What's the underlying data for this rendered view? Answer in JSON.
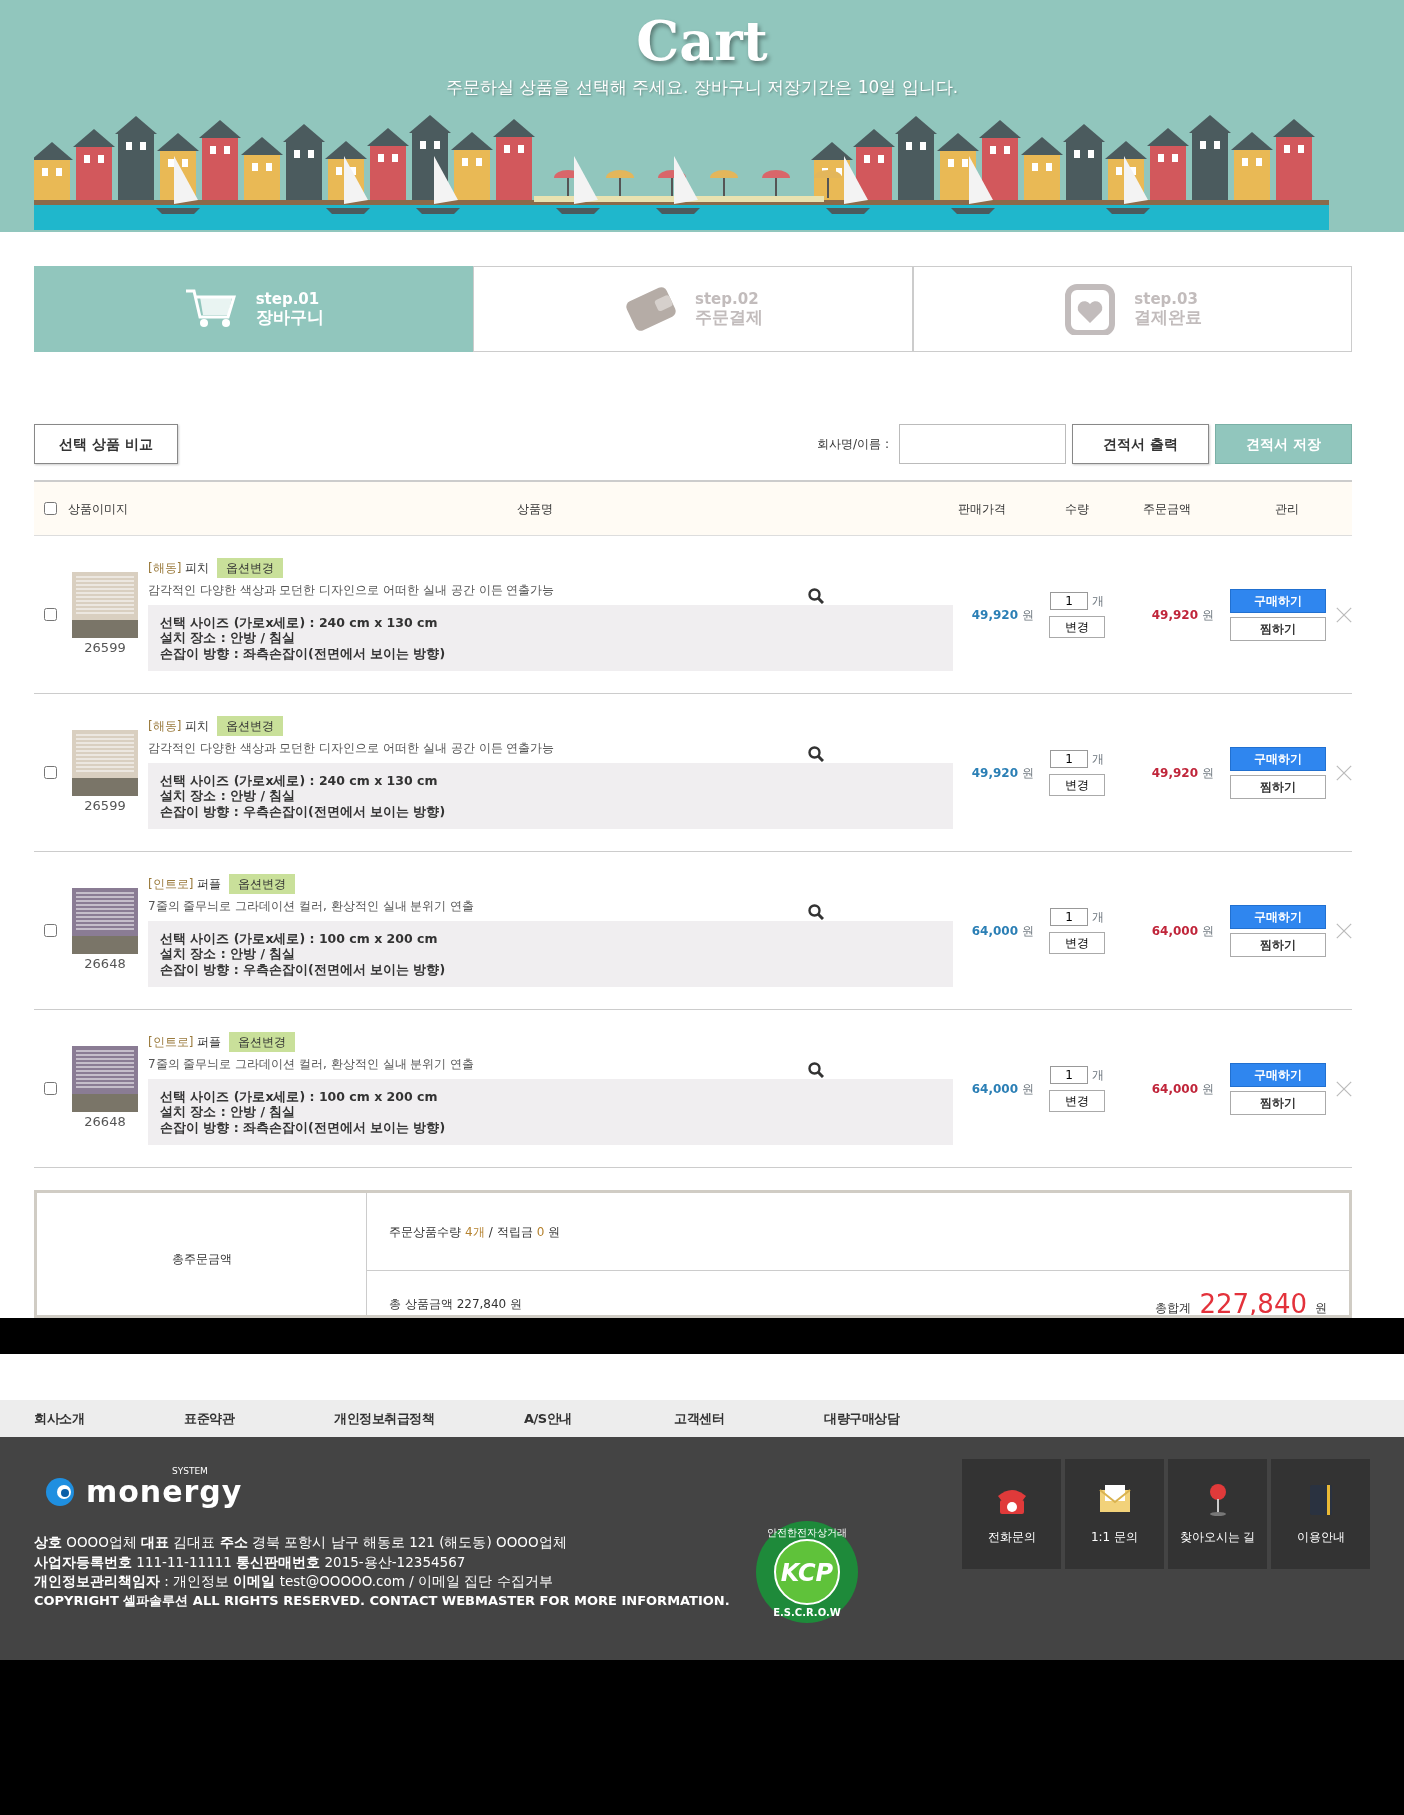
{
  "header": {
    "title": "Cart",
    "subtitle": "주문하실 상품을 선택해 주세요. 장바구니 저장기간은 10일 입니다."
  },
  "steps": [
    {
      "number": "step.01",
      "label": "장바구니",
      "selected": true,
      "kind": "cart"
    },
    {
      "number": "step.02",
      "label": "주문결제",
      "selected": false,
      "kind": "wallet"
    },
    {
      "number": "step.03",
      "label": "결제완료",
      "selected": false,
      "kind": "heart"
    }
  ],
  "toolbar": {
    "compare_button": "선택 상품 비교",
    "company_label": "회사명/이름 :",
    "print_button": "견적서 출력",
    "save_button": "견적서 저장"
  },
  "table": {
    "select_all": {
      "checked": false
    },
    "columns": [
      "상품이미지",
      "상품명",
      "판매가격",
      "수량",
      "주문금액",
      "관리"
    ],
    "rows": [
      {
        "checked": false,
        "color": "#d9cfc0",
        "code": "26599",
        "brand": "[해동]",
        "name": "피치",
        "option_button": "옵션변경",
        "description": "감각적인 다양한 색상과 모던한 디자인으로 어떠한 실내 공간 이든 연출가능",
        "options": [
          "선택 사이즈 (가로x세로) : 240 cm x 130 cm",
          "설치 장소 : 안방 / 침실",
          "손잡이 방향 : 좌측손잡이(전면에서 보이는 방향)"
        ],
        "price": "49,920",
        "price_unit": "원",
        "quantity": "1",
        "quantity_unit": "개",
        "change_button": "변경",
        "total": "49,920",
        "total_unit": "원",
        "buy_button": "구매하기",
        "wish_button": "찜하기"
      },
      {
        "checked": false,
        "color": "#d9cfc0",
        "code": "26599",
        "brand": "[해동]",
        "name": "피치",
        "option_button": "옵션변경",
        "description": "감각적인 다양한 색상과 모던한 디자인으로 어떠한 실내 공간 이든 연출가능",
        "options": [
          "선택 사이즈 (가로x세로) : 240 cm x 130 cm",
          "설치 장소 : 안방 / 침실",
          "손잡이 방향 : 우측손잡이(전면에서 보이는 방향)"
        ],
        "price": "49,920",
        "price_unit": "원",
        "quantity": "1",
        "quantity_unit": "개",
        "change_button": "변경",
        "total": "49,920",
        "total_unit": "원",
        "buy_button": "구매하기",
        "wish_button": "찜하기"
      },
      {
        "checked": false,
        "color": "#8a7c94",
        "code": "26648",
        "brand": "[인트로]",
        "name": "퍼플",
        "option_button": "옵션변경",
        "description": "7줄의 줄무늬로 그라데이션 컬러, 환상적인 실내 분위기 연출",
        "options": [
          "선택 사이즈 (가로x세로) : 100 cm x 200 cm",
          "설치 장소 : 안방 / 침실",
          "손잡이 방향 : 우측손잡이(전면에서 보이는 방향)"
        ],
        "price": "64,000",
        "price_unit": "원",
        "quantity": "1",
        "quantity_unit": "개",
        "change_button": "변경",
        "total": "64,000",
        "total_unit": "원",
        "buy_button": "구매하기",
        "wish_button": "찜하기"
      },
      {
        "checked": false,
        "color": "#8a7c94",
        "code": "26648",
        "brand": "[인트로]",
        "name": "퍼플",
        "option_button": "옵션변경",
        "description": "7줄의 줄무늬로 그라데이션 컬러, 환상적인 실내 분위기 연출",
        "options": [
          "선택 사이즈 (가로x세로) : 100 cm x 200 cm",
          "설치 장소 : 안방 / 침실",
          "손잡이 방향 : 좌측손잡이(전면에서 보이는 방향)"
        ],
        "price": "64,000",
        "price_unit": "원",
        "quantity": "1",
        "quantity_unit": "개",
        "change_button": "변경",
        "total": "64,000",
        "total_unit": "원",
        "buy_button": "구매하기",
        "wish_button": "찜하기"
      }
    ]
  },
  "summary": {
    "label": "총주문금액",
    "count_label": "주문상품수량",
    "count": "4개",
    "separator": "/",
    "points_label": "적립금",
    "points": "0",
    "points_unit": "원",
    "product_total": "총 상품금액 227,840 원",
    "grand_label": "총합계",
    "grand_total": "227,840",
    "grand_unit": "원"
  },
  "footer": {
    "links": [
      "회사소개",
      "표준약관",
      "개인정보취급정책",
      "A/S안내",
      "고객센터",
      "대량구매상담"
    ],
    "logo": {
      "text": "monergy",
      "tag": "SYSTEM"
    },
    "info": [
      "**상호** OOOO업체 **대표** 김대표 **주소** 경북 포항시 남구 해동로 121 (해도동) OOOO업체",
      "**사업자등록번호** 111-11-11111 **통신판매번호** 2015-용산-12354567",
      "**개인정보관리책임자** : 개인정보 **이메일** test@OOOOO.com / 이메일 집단 수집거부"
    ],
    "copyright": "COPYRIGHT 셀파솔루션 ALL RIGHTS RESERVED. CONTACT WEBMASTER FOR MORE INFORMATION.",
    "badge": {
      "text": "KCP",
      "top_ring": "안전한전자상거래",
      "bottom_ring": "E.S.C.R.O.W"
    },
    "quick_links": [
      {
        "kind": "phone",
        "label": "전화문의"
      },
      {
        "kind": "mail",
        "label": "1:1 문의"
      },
      {
        "kind": "pin",
        "label": "찾아오시는 길"
      },
      {
        "kind": "book",
        "label": "이용안내"
      }
    ]
  }
}
